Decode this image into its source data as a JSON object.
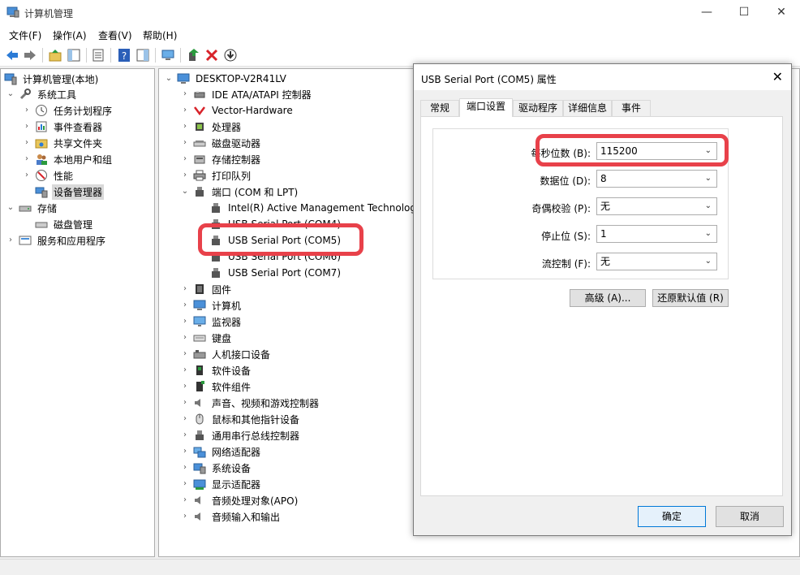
{
  "window": {
    "title": "计算机管理",
    "controls": {
      "minimize": "—",
      "maximize": "☐",
      "close": "✕"
    }
  },
  "menu": [
    "文件(F)",
    "操作(A)",
    "查看(V)",
    "帮助(H)"
  ],
  "left_tree": {
    "root": "计算机管理(本地)",
    "system_tools": "系统工具",
    "items": [
      "任务计划程序",
      "事件查看器",
      "共享文件夹",
      "本地用户和组",
      "性能",
      "设备管理器"
    ],
    "storage": "存储",
    "disk_mgmt": "磁盘管理",
    "services": "服务和应用程序"
  },
  "device_tree": {
    "root": "DESKTOP-V2R41LV",
    "categories_top": [
      "IDE ATA/ATAPI 控制器",
      "Vector-Hardware",
      "处理器",
      "磁盘驱动器",
      "存储控制器",
      "打印队列"
    ],
    "ports_category": "端口 (COM 和 LPT)",
    "ports": [
      "Intel(R) Active Management Technology",
      "USB Serial Port (COM4)",
      "USB Serial Port (COM5)",
      "USB Serial Port (COM6)",
      "USB Serial Port (COM7)"
    ],
    "categories_bottom": [
      "固件",
      "计算机",
      "监视器",
      "键盘",
      "人机接口设备",
      "软件设备",
      "软件组件",
      "声音、视频和游戏控制器",
      "鼠标和其他指针设备",
      "通用串行总线控制器",
      "网络适配器",
      "系统设备",
      "显示适配器",
      "音频处理对象(APO)",
      "音频输入和输出"
    ]
  },
  "dialog": {
    "title": "USB Serial Port (COM5) 属性",
    "close": "✕",
    "tabs": [
      "常规",
      "端口设置",
      "驱动程序",
      "详细信息",
      "事件"
    ],
    "active_tab": "端口设置",
    "fields": [
      {
        "label": "每秒位数 (B):",
        "value": "115200"
      },
      {
        "label": "数据位 (D):",
        "value": "8"
      },
      {
        "label": "奇偶校验 (P):",
        "value": "无"
      },
      {
        "label": "停止位 (S):",
        "value": "1"
      },
      {
        "label": "流控制 (F):",
        "value": "无"
      }
    ],
    "advanced_button": "高级 (A)...",
    "restore_button": "还原默认值 (R)",
    "ok_button": "确定",
    "cancel_button": "取消"
  },
  "colors": {
    "highlight": "#e8414a",
    "accent": "#0078d7"
  }
}
